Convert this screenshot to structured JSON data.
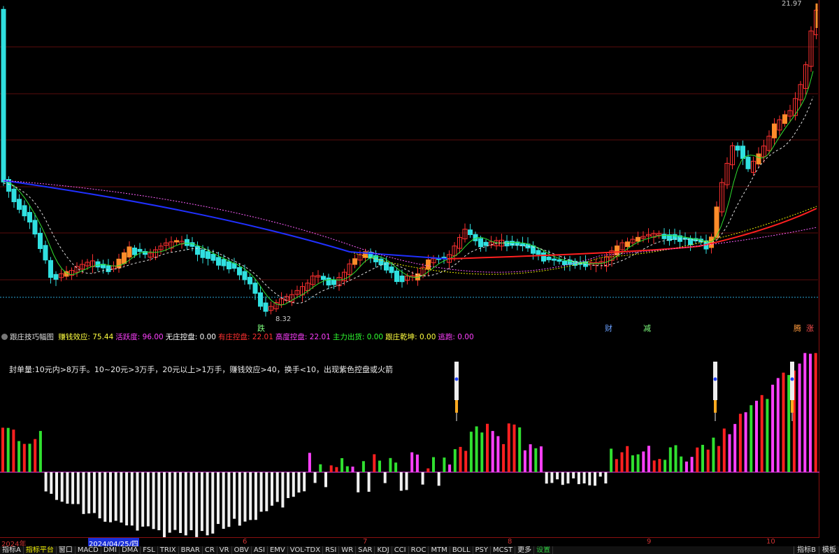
{
  "main_chart": {
    "high_label": "21.97",
    "low_label": "8.32",
    "signals": [
      {
        "text": "跌",
        "color": "#7fff7f"
      },
      {
        "text": "财",
        "color": "#6aa0ff"
      },
      {
        "text": "减",
        "color": "#7fff7f"
      },
      {
        "text": "腾",
        "color": "#ff9a3c"
      },
      {
        "text": "涨",
        "color": "#ff5050"
      }
    ]
  },
  "indicator": {
    "name": "跟庄技巧幅图",
    "fields": [
      {
        "label": "赚钱效应: 75.44",
        "color": "#ffff40"
      },
      {
        "label": "活跃度: 96.00",
        "color": "#ff40ff"
      },
      {
        "label": "无庄控盘: 0.00",
        "color": "#ffffff"
      },
      {
        "label": "有庄控盘: 22.01",
        "color": "#ff3030"
      },
      {
        "label": "高度控盘: 22.01",
        "color": "#ff40ff"
      },
      {
        "label": "主力出货: 0.00",
        "color": "#30ff30"
      },
      {
        "label": "跟庄乾坤: 0.00",
        "color": "#ffff40"
      },
      {
        "label": "逃跑: 0.00",
        "color": "#ff40ff"
      }
    ],
    "note": "封单量:10元内>8万手。10~20元>3万手，20元以上>1万手，赚钱效应>40，换手<10，出现紫色控盘或火箭"
  },
  "date_axis": [
    {
      "text": "2024年",
      "cursor": false
    },
    {
      "text": "2024/04/25/四",
      "cursor": true
    },
    {
      "text": "6",
      "cursor": false
    },
    {
      "text": "7",
      "cursor": false
    },
    {
      "text": "8",
      "cursor": false
    },
    {
      "text": "9",
      "cursor": false
    },
    {
      "text": "10",
      "cursor": false
    }
  ],
  "tabs": [
    "指标A",
    "指标平台",
    "窗口",
    "MACD",
    "DMI",
    "DMA",
    "FSL",
    "TRIX",
    "BRAR",
    "CR",
    "VR",
    "OBV",
    "ASI",
    "EMV",
    "VOL-TDX",
    "RSI",
    "WR",
    "SAR",
    "KDJ",
    "CCI",
    "ROC",
    "MTM",
    "BOLL",
    "PSY",
    "MCST",
    "更多",
    "设置"
  ],
  "active_tab": "指标平台",
  "right_tabs": [
    "指标B",
    "模板"
  ],
  "colors": {
    "up": "#ff3030",
    "down": "#30e0e0",
    "grid": "#6a0c0c",
    "accent": "#e8e800"
  }
}
